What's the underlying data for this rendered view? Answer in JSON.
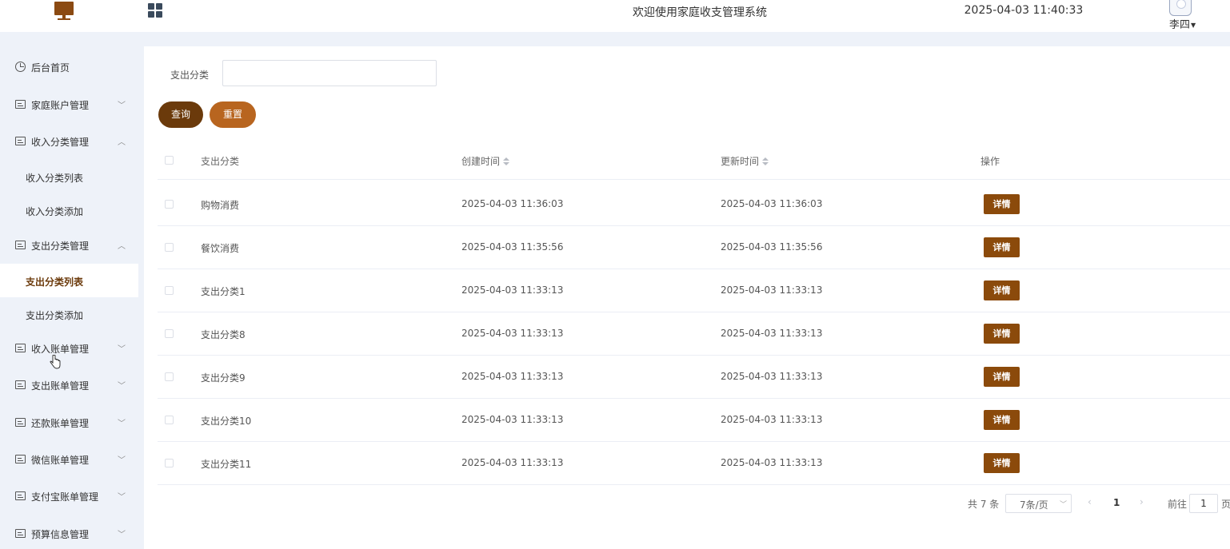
{
  "header": {
    "title": "欢迎使用家庭收支管理系统",
    "datetime": "2025-04-03 11:40:33",
    "username": "李四",
    "logo_icon": "computer-monitor-icon",
    "menu_icon": "grid-icon"
  },
  "sidebar": {
    "items": [
      {
        "label": "后台首页",
        "icon": "home-icon"
      },
      {
        "label": "家庭账户管理",
        "icon": "list-icon",
        "chevron": "﹀"
      },
      {
        "label": "收入分类管理",
        "icon": "list-icon",
        "chevron": "︿"
      },
      {
        "label": "收入分类列表"
      },
      {
        "label": "收入分类添加"
      },
      {
        "label": "支出分类管理",
        "icon": "list-icon",
        "chevron": "︿"
      },
      {
        "label": "支出分类列表",
        "active": true
      },
      {
        "label": "支出分类添加"
      },
      {
        "label": "收入账单管理",
        "icon": "list-icon",
        "chevron": "﹀"
      },
      {
        "label": "支出账单管理",
        "icon": "list-icon",
        "chevron": "﹀"
      },
      {
        "label": "还款账单管理",
        "icon": "list-icon",
        "chevron": "﹀"
      },
      {
        "label": "微信账单管理",
        "icon": "list-icon",
        "chevron": "﹀"
      },
      {
        "label": "支付宝账单管理",
        "icon": "list-icon",
        "chevron": "﹀"
      },
      {
        "label": "预算信息管理",
        "icon": "list-icon",
        "chevron": "﹀"
      }
    ]
  },
  "filter": {
    "label": "支出分类",
    "value": "",
    "placeholder": "",
    "query_label": "查询",
    "reset_label": "重置"
  },
  "table": {
    "columns": [
      "支出分类",
      "创建时间",
      "更新时间",
      "操作"
    ],
    "rows": [
      {
        "name": "购物消费",
        "created": "2025-04-03 11:36:03",
        "updated": "2025-04-03 11:36:03",
        "action": "详情"
      },
      {
        "name": "餐饮消费",
        "created": "2025-04-03 11:35:56",
        "updated": "2025-04-03 11:35:56",
        "action": "详情"
      },
      {
        "name": "支出分类1",
        "created": "2025-04-03 11:33:13",
        "updated": "2025-04-03 11:33:13",
        "action": "详情"
      },
      {
        "name": "支出分类8",
        "created": "2025-04-03 11:33:13",
        "updated": "2025-04-03 11:33:13",
        "action": "详情"
      },
      {
        "name": "支出分类9",
        "created": "2025-04-03 11:33:13",
        "updated": "2025-04-03 11:33:13",
        "action": "详情"
      },
      {
        "name": "支出分类10",
        "created": "2025-04-03 11:33:13",
        "updated": "2025-04-03 11:33:13",
        "action": "详情"
      },
      {
        "name": "支出分类11",
        "created": "2025-04-03 11:33:13",
        "updated": "2025-04-03 11:33:13",
        "action": "详情"
      }
    ]
  },
  "pagination": {
    "total_text": "共 7 条",
    "page_size": "7条/页",
    "prev": "‹",
    "current_page": "1",
    "next": "›",
    "goto_label": "前往",
    "goto_value": "1",
    "page_suffix": "页"
  },
  "colors": {
    "brand_dark": "#6b3a0b",
    "brand_light": "#b8651f",
    "detail_button": "#8b4a0b"
  }
}
